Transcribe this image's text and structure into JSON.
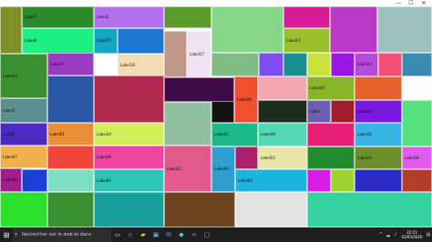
{
  "window": {
    "minimize": "—",
    "maximize": "☐",
    "close": "✕"
  },
  "tiles": [
    {
      "id": 1,
      "label": "",
      "color": "#7f8f2a"
    },
    {
      "id": 2,
      "label": "Label7",
      "color": "#2c8a2a"
    },
    {
      "id": 3,
      "label": "Label3",
      "color": "#b46ef0"
    },
    {
      "id": 4,
      "label": "",
      "color": "#5c9a2d"
    },
    {
      "id": 5,
      "label": "",
      "color": "#86d68a"
    },
    {
      "id": 6,
      "label": "",
      "color": "#d61c94"
    },
    {
      "id": 7,
      "label": "",
      "color": "#b83ac6"
    },
    {
      "id": 8,
      "label": "",
      "color": "#9fc1c0"
    },
    {
      "id": 9,
      "label": "Label8",
      "color": "#1bf085"
    },
    {
      "id": 10,
      "label": "Label15",
      "color": "#0fa7c4"
    },
    {
      "id": 11,
      "label": "",
      "color": "#1d78d2"
    },
    {
      "id": 12,
      "label": "Label12",
      "color": "#9bbf2b"
    },
    {
      "id": 13,
      "label": "",
      "color": "#6d2bd6"
    },
    {
      "id": 14,
      "label": "Label19",
      "color": "#3a8f2e"
    },
    {
      "id": 15,
      "label": "Label17",
      "color": "#9c3bc4"
    },
    {
      "id": 16,
      "label": "Label18",
      "color": "#f3dcb4"
    },
    {
      "id": 17,
      "label": "",
      "color": "#c09886"
    },
    {
      "id": 18,
      "label": "Label17",
      "color": "#efe2f2"
    },
    {
      "id": 19,
      "label": "",
      "color": "#7fbc84"
    },
    {
      "id": 20,
      "label": "",
      "color": "#7f4cf0"
    },
    {
      "id": 21,
      "label": "",
      "color": "#198f92"
    },
    {
      "id": 22,
      "label": "",
      "color": "#c7e33b"
    },
    {
      "id": 23,
      "label": "",
      "color": "#9a18e4"
    },
    {
      "id": 24,
      "label": "Label23",
      "color": "#b64adb"
    },
    {
      "id": 25,
      "label": "",
      "color": "#f54f74"
    },
    {
      "id": 26,
      "label": "",
      "color": "#3b8cb5"
    },
    {
      "id": 27,
      "label": "",
      "color": "#3f0a45"
    },
    {
      "id": 28,
      "label": "Label39",
      "color": "#f04f30"
    },
    {
      "id": 29,
      "label": "",
      "color": "#f3a7b1"
    },
    {
      "id": 30,
      "label": "Label30",
      "color": "#88b62a"
    },
    {
      "id": 31,
      "label": "",
      "color": "#e4632c"
    },
    {
      "id": 32,
      "label": "Label2",
      "color": "#5c8f8f"
    },
    {
      "id": 33,
      "label": "",
      "color": "#2b58a6"
    },
    {
      "id": 34,
      "label": "",
      "color": "#b0284e"
    },
    {
      "id": 35,
      "label": "",
      "color": "#111111"
    },
    {
      "id": 36,
      "label": "",
      "color": "#1d2e20"
    },
    {
      "id": 37,
      "label": "Label",
      "color": "#6a5fb1"
    },
    {
      "id": 38,
      "label": "",
      "color": "#9f1e2b"
    },
    {
      "id": 39,
      "label": "Label55",
      "color": "#7a1ae0"
    },
    {
      "id": 40,
      "label": "",
      "color": "#55e27c"
    },
    {
      "id": 41,
      "label": "Label5",
      "color": "#4a2ac0"
    },
    {
      "id": 42,
      "label": "Label61",
      "color": "#ea8f36"
    },
    {
      "id": 43,
      "label": "Label34",
      "color": "#d2f05c"
    },
    {
      "id": 44,
      "label": "",
      "color": "#8fc1a1"
    },
    {
      "id": 45,
      "label": "Label41",
      "color": "#1cb98a"
    },
    {
      "id": 46,
      "label": "Label49",
      "color": "#55d6b5"
    },
    {
      "id": 47,
      "label": "",
      "color": "#e51e76"
    },
    {
      "id": 48,
      "label": "Label45",
      "color": "#38b4e6"
    },
    {
      "id": 49,
      "label": "Label47",
      "color": "#f2b04d"
    },
    {
      "id": 50,
      "label": "",
      "color": "#f0463a"
    },
    {
      "id": 51,
      "label": "Label38",
      "color": "#ee46a0"
    },
    {
      "id": 52,
      "label": "Label52",
      "color": "#e05a8e"
    },
    {
      "id": 53,
      "label": "Label46",
      "color": "#2f9fcf"
    },
    {
      "id": 54,
      "label": "",
      "color": "#ad1f6a"
    },
    {
      "id": 55,
      "label": "Label53",
      "color": "#e9e5a6"
    },
    {
      "id": 56,
      "label": "",
      "color": "#1f8d2e"
    },
    {
      "id": 57,
      "label": "Label34",
      "color": "#6d8e2c"
    },
    {
      "id": 58,
      "label": "Label36",
      "color": "#e25cf0"
    },
    {
      "id": 59,
      "label": "Label36",
      "color": "#a01f8d"
    },
    {
      "id": 60,
      "label": "",
      "color": "#1a3fd6"
    },
    {
      "id": 61,
      "label": "",
      "color": "#7bdfc2"
    },
    {
      "id": 62,
      "label": "Label60",
      "color": "#2ec4b6"
    },
    {
      "id": 63,
      "label": "Label64",
      "color": "#1bb5e0"
    },
    {
      "id": 64,
      "label": "",
      "color": "#d71ce8"
    },
    {
      "id": 65,
      "label": "",
      "color": "#9bd430"
    },
    {
      "id": 66,
      "label": "",
      "color": "#2b2bc8"
    },
    {
      "id": 67,
      "label": "",
      "color": "#b33c2a"
    },
    {
      "id": 68,
      "label": "",
      "color": "#2ce02c"
    },
    {
      "id": 69,
      "label": "",
      "color": "#3a8f2e"
    },
    {
      "id": 70,
      "label": "",
      "color": "#1b9e9e"
    },
    {
      "id": 71,
      "label": "",
      "color": "#6c4420"
    },
    {
      "id": 72,
      "label": "",
      "color": "#e2e2e2"
    },
    {
      "id": 73,
      "label": "",
      "color": "#35d1a0"
    }
  ],
  "taskbar": {
    "start_glyph": "⊞",
    "search_placeholder": "Rechercher sur le web et dans Windows",
    "search_glyph": "⌕",
    "clock_time": "22:21",
    "clock_date": "03/05/2020"
  }
}
